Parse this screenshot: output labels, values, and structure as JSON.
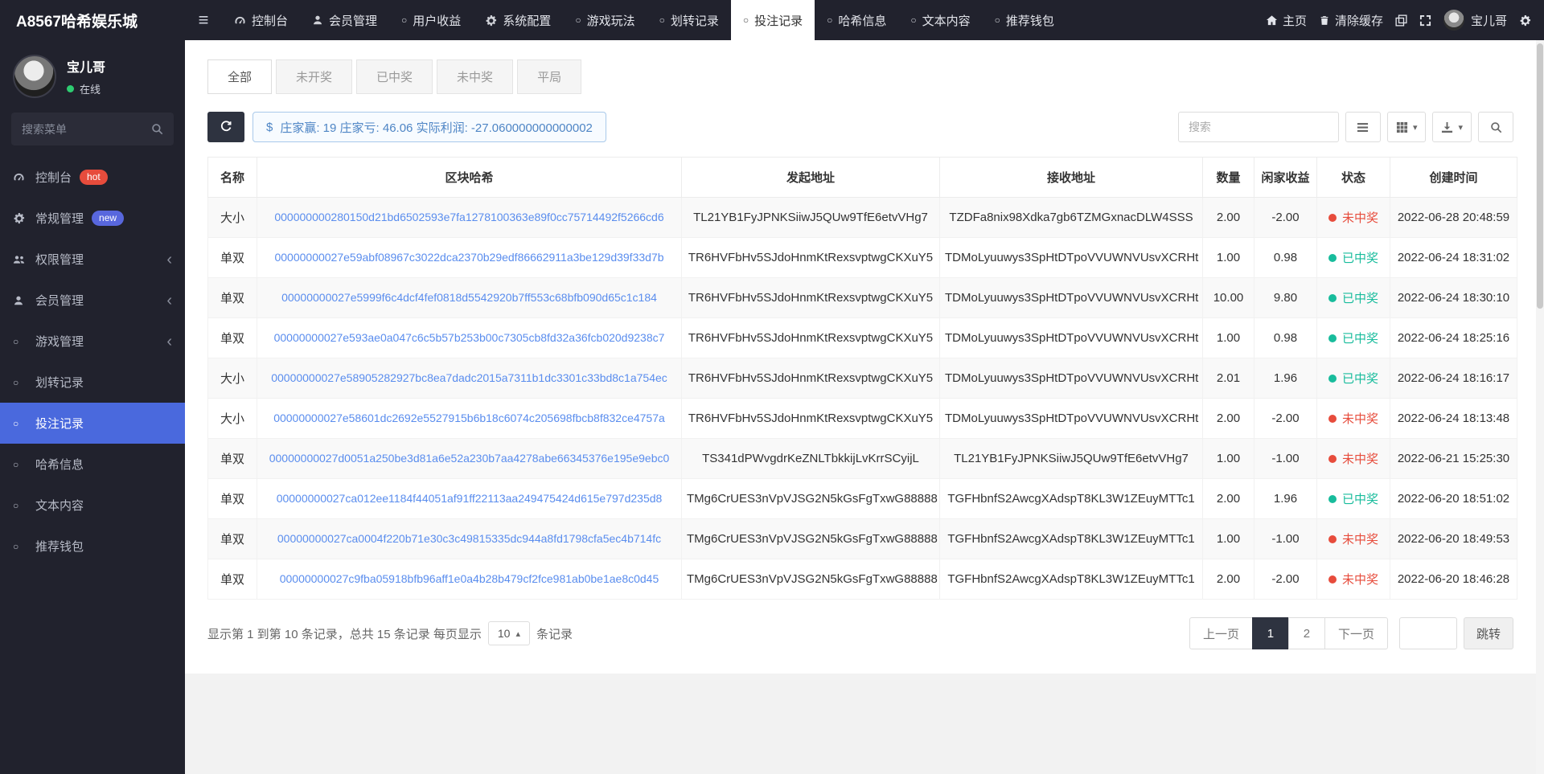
{
  "colors": {
    "accent": "#4a69dd",
    "link": "#5a8dee",
    "win": "#18bc9c",
    "lose": "#e74c3c",
    "dark": "#21222d",
    "badge_hot": "#e74c3c",
    "badge_new": "#5867dd"
  },
  "topbar": {
    "brand": "A8567哈希娱乐城",
    "nav": [
      {
        "label": "控制台",
        "icon": "dashboard-icon"
      },
      {
        "label": "会员管理",
        "icon": "user-icon"
      },
      {
        "label": "用户收益",
        "icon": "circle-icon"
      },
      {
        "label": "系统配置",
        "icon": "gear-icon"
      },
      {
        "label": "游戏玩法",
        "icon": "circle-icon"
      },
      {
        "label": "划转记录",
        "icon": "circle-icon"
      },
      {
        "label": "投注记录",
        "icon": "circle-icon",
        "active": true
      },
      {
        "label": "哈希信息",
        "icon": "circle-icon"
      },
      {
        "label": "文本内容",
        "icon": "circle-icon"
      },
      {
        "label": "推荐钱包",
        "icon": "circle-icon"
      }
    ],
    "home_label": "主页",
    "clear_cache_label": "清除缓存",
    "username": "宝儿哥"
  },
  "sidebar": {
    "user": {
      "name": "宝儿哥",
      "status": "在线"
    },
    "search_placeholder": "搜索菜单",
    "menu": [
      {
        "label": "控制台",
        "icon": "dashboard-icon",
        "badge": "hot"
      },
      {
        "label": "常规管理",
        "icon": "gears-icon",
        "badge": "new"
      },
      {
        "label": "权限管理",
        "icon": "users-icon",
        "chevron": true
      },
      {
        "label": "会员管理",
        "icon": "user-icon",
        "chevron": true
      },
      {
        "label": "游戏管理",
        "icon": "circle-icon",
        "chevron": true
      },
      {
        "label": "划转记录",
        "icon": "circle-icon"
      },
      {
        "label": "投注记录",
        "icon": "circle-icon",
        "active": true
      },
      {
        "label": "哈希信息",
        "icon": "circle-icon"
      },
      {
        "label": "文本内容",
        "icon": "circle-icon"
      },
      {
        "label": "推荐钱包",
        "icon": "circle-icon"
      }
    ]
  },
  "tabs": [
    {
      "label": "全部",
      "active": true
    },
    {
      "label": "未开奖"
    },
    {
      "label": "已中奖"
    },
    {
      "label": "未中奖"
    },
    {
      "label": "平局"
    }
  ],
  "toolbar": {
    "summary_prefix": "$",
    "summary": "庄家赢: 19 庄家亏: 46.06 实际利润: -27.060000000000002",
    "search_placeholder": "搜索"
  },
  "table": {
    "columns": [
      "名称",
      "区块哈希",
      "发起地址",
      "接收地址",
      "数量",
      "闲家收益",
      "状态",
      "创建时间"
    ],
    "rows": [
      {
        "name": "大小",
        "hash": "000000000280150d21bd6502593e7fa1278100363e89f0cc75714492f5266cd6",
        "from": "TL21YB1FyJPNKSiiwJ5QUw9TfE6etvVHg7",
        "to": "TZDFa8nix98Xdka7gb6TZMGxnacDLW4SSS",
        "amount": "2.00",
        "profit": "-2.00",
        "status": "未中奖",
        "status_type": "lose",
        "time": "2022-06-28 20:48:59"
      },
      {
        "name": "单双",
        "hash": "00000000027e59abf08967c3022dca2370b29edf86662911a3be129d39f33d7b",
        "from": "TR6HVFbHv5SJdoHnmKtRexsvptwgCKXuY5",
        "to": "TDMoLyuuwys3SpHtDTpoVVUWNVUsvXCRHt",
        "amount": "1.00",
        "profit": "0.98",
        "status": "已中奖",
        "status_type": "win",
        "time": "2022-06-24 18:31:02"
      },
      {
        "name": "单双",
        "hash": "00000000027e5999f6c4dcf4fef0818d5542920b7ff553c68bfb090d65c1c184",
        "from": "TR6HVFbHv5SJdoHnmKtRexsvptwgCKXuY5",
        "to": "TDMoLyuuwys3SpHtDTpoVVUWNVUsvXCRHt",
        "amount": "10.00",
        "profit": "9.80",
        "status": "已中奖",
        "status_type": "win",
        "time": "2022-06-24 18:30:10"
      },
      {
        "name": "单双",
        "hash": "00000000027e593ae0a047c6c5b57b253b00c7305cb8fd32a36fcb020d9238c7",
        "from": "TR6HVFbHv5SJdoHnmKtRexsvptwgCKXuY5",
        "to": "TDMoLyuuwys3SpHtDTpoVVUWNVUsvXCRHt",
        "amount": "1.00",
        "profit": "0.98",
        "status": "已中奖",
        "status_type": "win",
        "time": "2022-06-24 18:25:16"
      },
      {
        "name": "大小",
        "hash": "00000000027e58905282927bc8ea7dadc2015a7311b1dc3301c33bd8c1a754ec",
        "from": "TR6HVFbHv5SJdoHnmKtRexsvptwgCKXuY5",
        "to": "TDMoLyuuwys3SpHtDTpoVVUWNVUsvXCRHt",
        "amount": "2.01",
        "profit": "1.96",
        "status": "已中奖",
        "status_type": "win",
        "time": "2022-06-24 18:16:17"
      },
      {
        "name": "大小",
        "hash": "00000000027e58601dc2692e5527915b6b18c6074c205698fbcb8f832ce4757a",
        "from": "TR6HVFbHv5SJdoHnmKtRexsvptwgCKXuY5",
        "to": "TDMoLyuuwys3SpHtDTpoVVUWNVUsvXCRHt",
        "amount": "2.00",
        "profit": "-2.00",
        "status": "未中奖",
        "status_type": "lose",
        "time": "2022-06-24 18:13:48"
      },
      {
        "name": "单双",
        "hash": "00000000027d0051a250be3d81a6e52a230b7aa4278abe66345376e195e9ebc0",
        "from": "TS341dPWvgdrKeZNLTbkkijLvKrrSCyijL",
        "to": "TL21YB1FyJPNKSiiwJ5QUw9TfE6etvVHg7",
        "amount": "1.00",
        "profit": "-1.00",
        "status": "未中奖",
        "status_type": "lose",
        "time": "2022-06-21 15:25:30"
      },
      {
        "name": "单双",
        "hash": "00000000027ca012ee1184f44051af91ff22113aa249475424d615e797d235d8",
        "from": "TMg6CrUES3nVpVJSG2N5kGsFgTxwG88888",
        "to": "TGFHbnfS2AwcgXAdspT8KL3W1ZEuyMTTc1",
        "amount": "2.00",
        "profit": "1.96",
        "status": "已中奖",
        "status_type": "win",
        "time": "2022-06-20 18:51:02"
      },
      {
        "name": "单双",
        "hash": "00000000027ca0004f220b71e30c3c49815335dc944a8fd1798cfa5ec4b714fc",
        "from": "TMg6CrUES3nVpVJSG2N5kGsFgTxwG88888",
        "to": "TGFHbnfS2AwcgXAdspT8KL3W1ZEuyMTTc1",
        "amount": "1.00",
        "profit": "-1.00",
        "status": "未中奖",
        "status_type": "lose",
        "time": "2022-06-20 18:49:53"
      },
      {
        "name": "单双",
        "hash": "00000000027c9fba05918bfb96aff1e0a4b28b479cf2fce981ab0be1ae8c0d45",
        "from": "TMg6CrUES3nVpVJSG2N5kGsFgTxwG88888",
        "to": "TGFHbnfS2AwcgXAdspT8KL3W1ZEuyMTTc1",
        "amount": "2.00",
        "profit": "-2.00",
        "status": "未中奖",
        "status_type": "lose",
        "time": "2022-06-20 18:46:28"
      }
    ]
  },
  "pagination": {
    "info_before": "显示第 1 到第 10 条记录，总共 15 条记录 每页显示",
    "page_size": "10",
    "info_after": "条记录",
    "prev": "上一页",
    "next": "下一页",
    "pages": [
      "1",
      "2"
    ],
    "active_page": "1",
    "jump_label": "跳转"
  }
}
